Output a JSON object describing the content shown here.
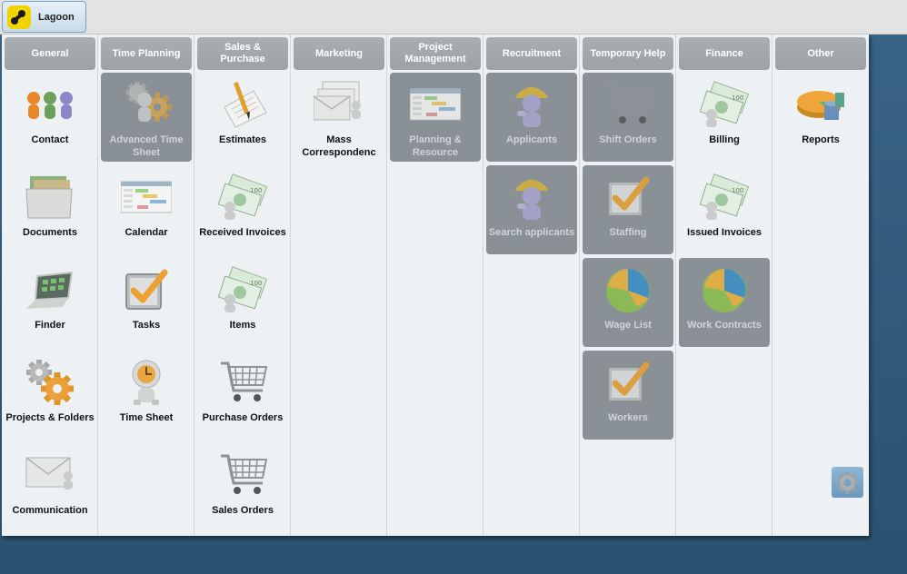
{
  "app": {
    "name": "Lagoon"
  },
  "columns": [
    {
      "header": "General",
      "items": [
        {
          "label": "Contact",
          "icon": "people-icon",
          "selected": false
        },
        {
          "label": "Documents",
          "icon": "folder-icon",
          "selected": false
        },
        {
          "label": "Finder",
          "icon": "laptop-icon",
          "selected": false
        },
        {
          "label": "Projects & Folders",
          "icon": "gears-icon",
          "selected": false
        },
        {
          "label": "Communication",
          "icon": "envelope-icon",
          "selected": false
        }
      ]
    },
    {
      "header": "Time Planning",
      "items": [
        {
          "label": "Advanced Time Sheet",
          "icon": "gear-figure-icon",
          "selected": true
        },
        {
          "label": "Calendar",
          "icon": "calendar-icon",
          "selected": false
        },
        {
          "label": "Tasks",
          "icon": "checkbox-icon",
          "selected": false
        },
        {
          "label": "Time Sheet",
          "icon": "clock-figure-icon",
          "selected": false
        }
      ]
    },
    {
      "header": "Sales & Purchase",
      "items": [
        {
          "label": "Estimates",
          "icon": "pencil-paper-icon",
          "selected": false
        },
        {
          "label": "Received Invoices",
          "icon": "money-icon",
          "selected": false
        },
        {
          "label": "Items",
          "icon": "money-icon",
          "selected": false
        },
        {
          "label": "Purchase Orders",
          "icon": "cart-icon",
          "selected": false
        },
        {
          "label": "Sales Orders",
          "icon": "cart-icon",
          "selected": false
        }
      ]
    },
    {
      "header": "Marketing",
      "items": [
        {
          "label": "Mass Correspondenc",
          "icon": "envelopes-icon",
          "selected": false
        }
      ]
    },
    {
      "header": "Project Management",
      "items": [
        {
          "label": "Planning & Resource",
          "icon": "calendar-icon",
          "selected": true
        }
      ]
    },
    {
      "header": "Recruitment",
      "items": [
        {
          "label": "Applicants",
          "icon": "worker-icon",
          "selected": true
        },
        {
          "label": "Search applicants",
          "icon": "worker-icon",
          "selected": true
        }
      ]
    },
    {
      "header": "Temporary Help",
      "items": [
        {
          "label": "Shift Orders",
          "icon": "cart-icon",
          "selected": true
        },
        {
          "label": "Staffing",
          "icon": "checkbox-icon",
          "selected": true
        },
        {
          "label": "Wage List",
          "icon": "pie-chart-icon",
          "selected": true
        },
        {
          "label": "Workers",
          "icon": "checkbox-icon",
          "selected": true
        }
      ]
    },
    {
      "header": "Finance",
      "items": [
        {
          "label": "Billing",
          "icon": "money-icon",
          "selected": false
        },
        {
          "label": "Issued Invoices",
          "icon": "money-icon",
          "selected": false
        },
        {
          "label": "Work Contracts",
          "icon": "pie-chart-icon",
          "selected": true
        }
      ]
    },
    {
      "header": "Other",
      "items": [
        {
          "label": "Reports",
          "icon": "3d-pie-chart-icon",
          "selected": false
        }
      ]
    }
  ],
  "colors": {
    "desktop": "#2f5677",
    "panel": "#edf1f3",
    "header": "#a4a9ad",
    "selected_tile": "#8a9196",
    "accent_orange": "#f0a030"
  }
}
